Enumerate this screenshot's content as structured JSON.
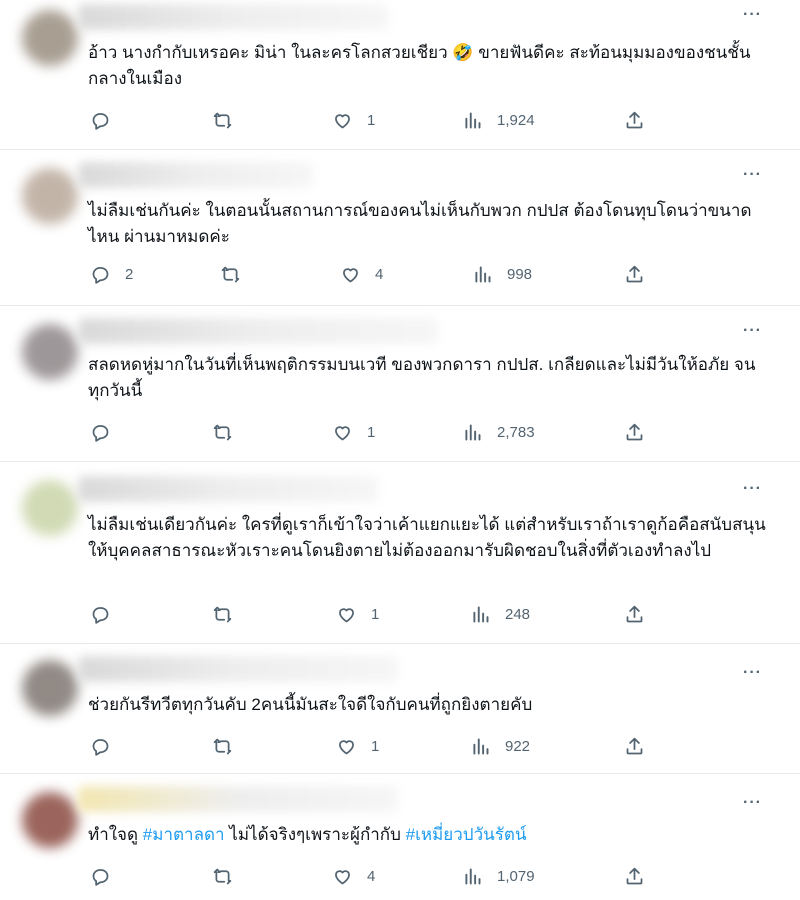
{
  "tweets": [
    {
      "text": "อ้าว นางกำกับเหรอคะ มิน่า ในละครโลกสวยเชียว 🤣 ขายฟันดีคะ สะท้อนมุมมองของชนชั้นกลางในเมือง",
      "replies": "",
      "likes": "1",
      "views": "1,924",
      "avatar_color": "#9a8e80"
    },
    {
      "text": "ไม่ลืมเช่นกันค่ะ ในตอนนั้นสถานการณ์ของคนไม่เห็นกับพวก กปปส ต้องโดนทุบโดนว่าขนาดไหน ผ่านมาหมดค่ะ",
      "replies": "2",
      "likes": "4",
      "views": "998",
      "avatar_color": "#b9a89a"
    },
    {
      "text": "สลดหดหู่มากในวันที่เห็นพฤติกรรมบนเวที ของพวกดารา กปปส. เกลียดและไม่มีวันให้อภัย จนทุกวันนี้",
      "replies": "",
      "likes": "1",
      "views": "2,783",
      "avatar_color": "#8e8688"
    },
    {
      "text": "ไม่ลืมเช่นเดียวกันค่ะ ใครที่ดูเราก็เข้าใจว่าเค้าแยกแยะได้ แต่สำหรับเราถ้าเราดูก้อคือสนับสนุนให้บุคคลสาธารณะหัวเราะคนโดนยิงตายไม่ต้องออกมารับผิดชอบในสิ่งที่ตัวเองทำลงไป",
      "replies": "",
      "likes": "1",
      "views": "248",
      "avatar_color": "#c9d4a8"
    },
    {
      "text": "ช่วยกันรีทวีตทุกวันคับ 2คนนี้มันสะใจดีใจกับคนที่ถูกยิงตายคับ",
      "replies": "",
      "likes": "1",
      "views": "922",
      "avatar_color": "#7e7670"
    },
    {
      "text_before": "ทำใจดู ",
      "hashtag1": "#มาตาลดา",
      "text_middle": " ไม่ได้จริงๆเพราะผู้กำกับ ",
      "hashtag2": "#เหมี่ยวปวันรัตน์",
      "replies": "",
      "likes": "4",
      "views": "1,079",
      "avatar_color": "#8a4a40"
    }
  ],
  "more_label": "···",
  "colors": {
    "text": "#0f1419",
    "meta": "#536471",
    "link": "#1d9bf0",
    "divider": "#e6e9ec"
  },
  "icons": [
    "reply-icon",
    "retweet-icon",
    "like-icon",
    "views-icon",
    "share-icon",
    "more-icon"
  ]
}
